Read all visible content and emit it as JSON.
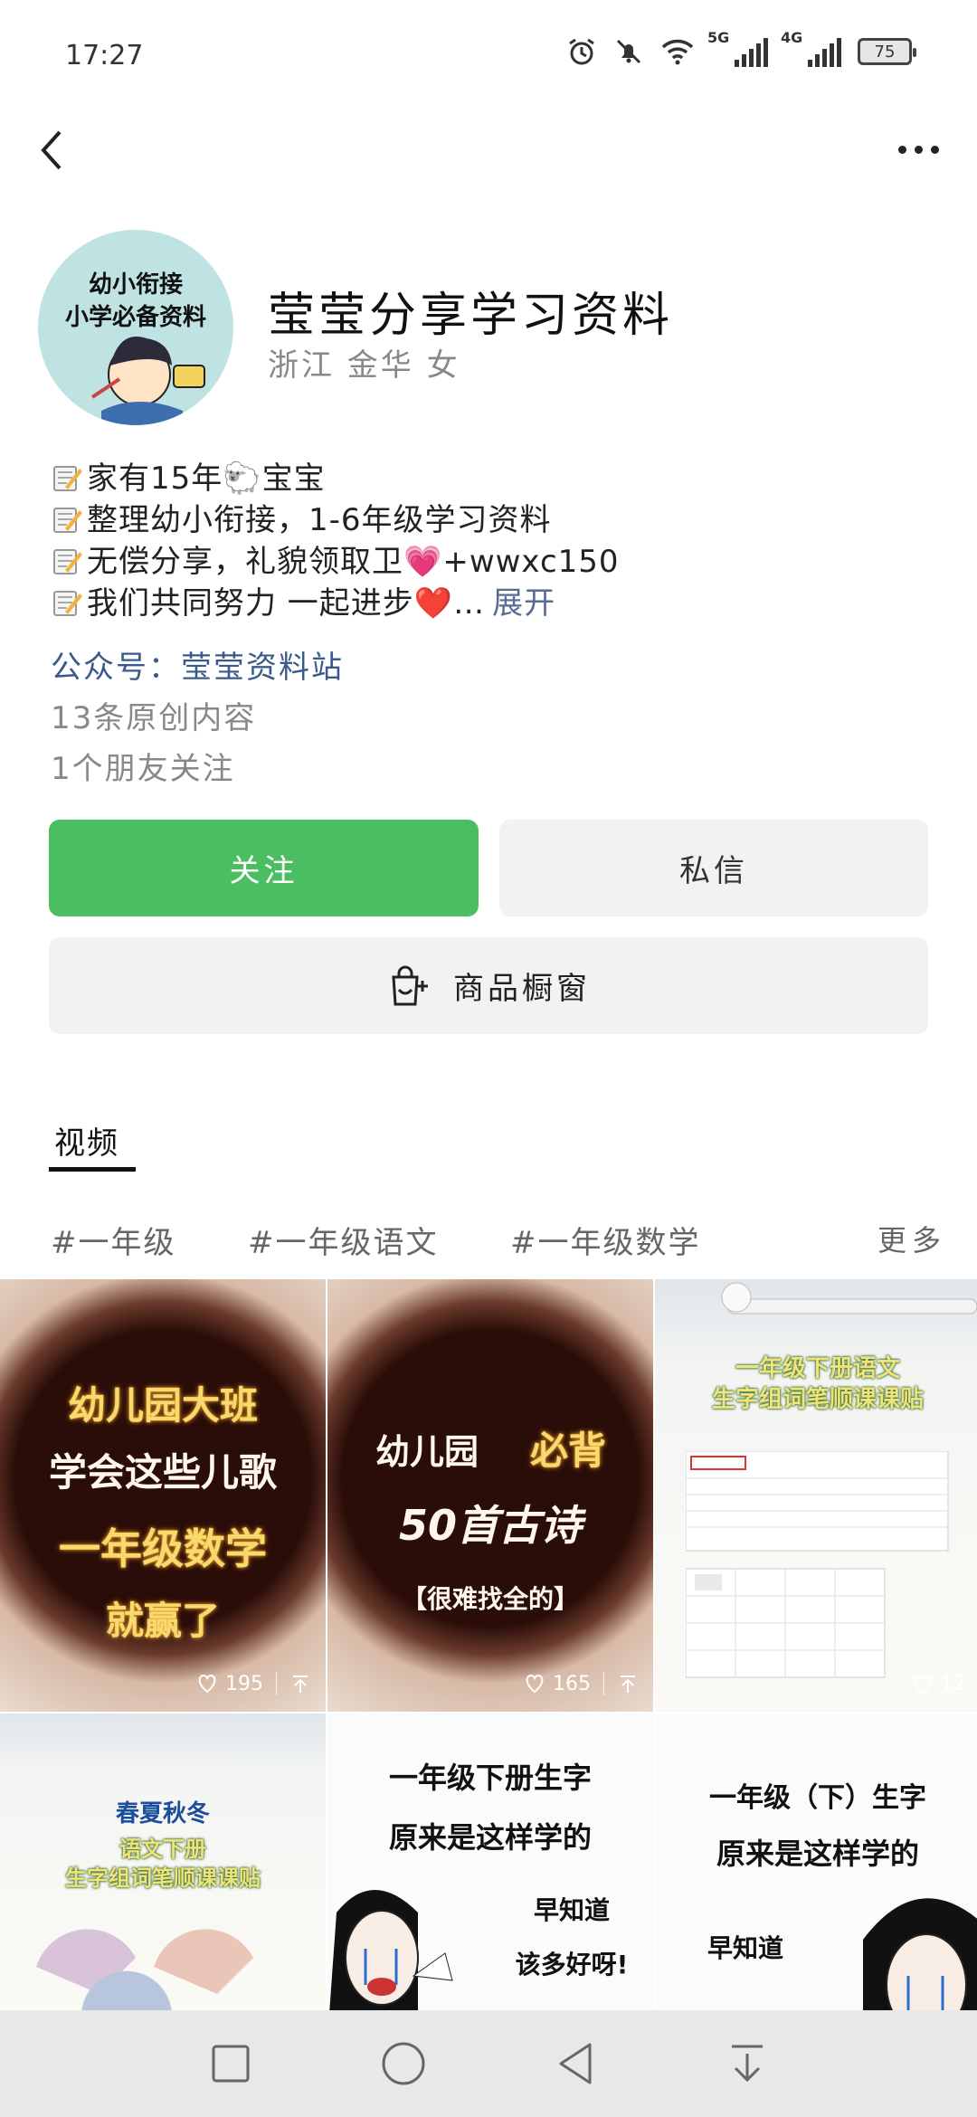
{
  "status": {
    "time": "17:27",
    "net1": "5G",
    "net2": "4G",
    "battery": "75"
  },
  "profile": {
    "avatar_lines": [
      "幼小衔接",
      "小学必备资料"
    ],
    "name": "莹莹分享学习资料",
    "location": "浙江 金华 女",
    "bio": [
      "家有15年🐑宝宝",
      "整理幼小衔接，1-6年级学习资料",
      "无偿分享，礼貌领取卫💗+wwxc150",
      "我们共同努力 一起进步❤️…"
    ],
    "expand_label": "展开",
    "official_account": "公众号：莹莹资料站",
    "originals": "13条原创内容",
    "friends": "1个朋友关注"
  },
  "buttons": {
    "follow": "关注",
    "message": "私信",
    "shop": "商品橱窗"
  },
  "tabs": {
    "video": "视频"
  },
  "tags": [
    "#一年级",
    "#一年级语文",
    "#一年级数学"
  ],
  "tags_more": "更多",
  "videos": [
    {
      "lines": [
        "幼儿园大班",
        "学会这些儿歌",
        "一年级数学",
        "就赢了"
      ],
      "likes": "195"
    },
    {
      "lines": [
        "幼儿园",
        "必背",
        "50首古诗",
        "【很难找全的】"
      ],
      "likes": "165"
    },
    {
      "lines": [
        "一年级下册语文",
        "生字组词笔顺课课贴"
      ],
      "likes": "12"
    },
    {
      "lines": [
        "春夏秋冬",
        "语文下册",
        "生字组词笔顺课课贴"
      ]
    },
    {
      "lines": [
        "一年级下册生字",
        "原来是这样学的",
        "早知道",
        "该多好呀!"
      ]
    },
    {
      "lines": [
        "一年级（下）生字",
        "原来是这样学的",
        "早知道"
      ]
    }
  ],
  "colors": {
    "follow_green": "#4cbe62",
    "link_blue": "#576b95"
  }
}
